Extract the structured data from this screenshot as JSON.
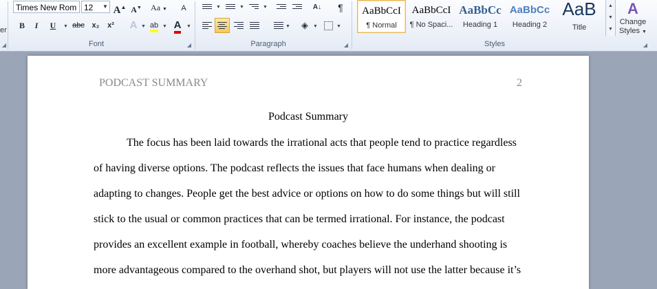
{
  "font": {
    "name": "Times New Rom",
    "size": "12",
    "group_label": "Font",
    "bold": "B",
    "italic": "I",
    "underline": "U",
    "strikethrough": "abc",
    "subscript": "x₂",
    "superscript": "x²",
    "grow": "A",
    "shrink": "A",
    "change_case": "Aa",
    "clear_format": "A",
    "text_effects": "A",
    "highlight": "ab",
    "font_color": "A"
  },
  "paragraph": {
    "group_label": "Paragraph"
  },
  "styles": {
    "group_label": "Styles",
    "items": [
      {
        "sample": "AaBbCcI",
        "name": "¶ Normal"
      },
      {
        "sample": "AaBbCcI",
        "name": "¶ No Spaci..."
      },
      {
        "sample": "AaBbCc",
        "name": "Heading 1"
      },
      {
        "sample": "AaBbCc",
        "name": "Heading 2"
      },
      {
        "sample": "AaB",
        "name": "Title"
      }
    ],
    "change_styles_line1": "Change",
    "change_styles_line2": "Styles",
    "cut_left_label": "er"
  },
  "document": {
    "header_title": "PODCAST SUMMARY",
    "page_number": "2",
    "title": "Podcast Summary",
    "lines": [
      "The focus has been laid towards the irrational  acts that people tend to practice regardless",
      "of having diverse options. The podcast reflects the issues that face humans when dealing or",
      "adapting to changes. People get the best advice or options on how to do some things but will still",
      "stick to the usual or common practices that can be termed irrational.  For instance, the podcast",
      "provides an excellent example in football, whereby coaches believe the underhand shooting is",
      "more advantageous compared to the overhand shot, but players will not use the latter because it’s"
    ]
  },
  "colors": {
    "accent_heading": "#365f91",
    "highlight": "#ffff00",
    "font_color": "#e00000"
  }
}
